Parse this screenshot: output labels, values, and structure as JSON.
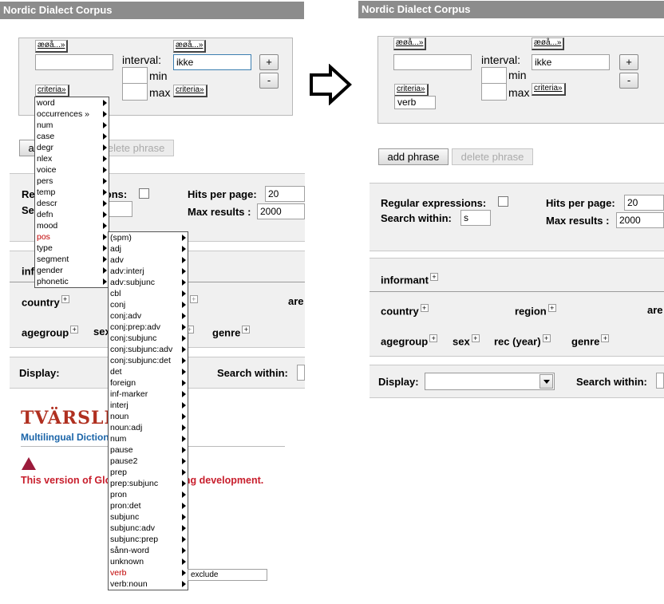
{
  "title": "Nordic Dialect Corpus",
  "query": {
    "char_btn": "æøå...»",
    "interval_label": "interval:",
    "min_label": "min",
    "max_label": "max",
    "criteria_btn": "criteria»",
    "right_value": "ikke",
    "plus_label": "+",
    "minus_label": "-",
    "criteria_result": "verb"
  },
  "phrase": {
    "add_label": "add phrase",
    "delete_label": "delete phrase"
  },
  "options": {
    "regex_label": "Regular expressions:",
    "search_within_label": "Search within:",
    "search_within_value": "s",
    "hits_label": "Hits per page:",
    "hits_value": "20",
    "max_label": "Max results :",
    "max_value": "2000"
  },
  "metadata": {
    "informant": "informant",
    "country": "country",
    "region": "region",
    "area": "are",
    "agegroup": "agegroup",
    "sex": "sex",
    "rec_year": "rec (year)",
    "genre": "genre"
  },
  "display": {
    "label": "Display:",
    "search_within": "Search within:"
  },
  "left_only": {
    "logo": "TVÄRSLEX",
    "logo_subtitle": "Multilingual Dictionary",
    "notice": "This version of Glossa is undergoing development.",
    "exclude_value": "exclude"
  },
  "criteria_menu": [
    "word",
    "occurrences »",
    "num",
    "case",
    "degr",
    "nlex",
    "voice",
    "pers",
    "temp",
    "descr",
    "defn",
    "mood",
    "pos",
    "type",
    "segment",
    "gender",
    "phonetic"
  ],
  "pos_menu": [
    "(spm)",
    "adj",
    "adv",
    "adv:interj",
    "adv:subjunc",
    "cbl",
    "conj",
    "conj:adv",
    "conj:prep:adv",
    "conj:subjunc",
    "conj:subjunc:adv",
    "conj:subjunc:det",
    "det",
    "foreign",
    "inf-marker",
    "interj",
    "noun",
    "noun:adj",
    "num",
    "pause",
    "pause2",
    "prep",
    "prep:subjunc",
    "pron",
    "pron:det",
    "subjunc",
    "subjunc:adv",
    "subjunc:prep",
    "sånn-word",
    "unknown",
    "verb",
    "verb:noun"
  ],
  "colors": {
    "title_bg": "#8c8c8c",
    "panel_bg": "#f0f0f0",
    "highlight": "#c00000",
    "link_blue": "#1a64a8"
  }
}
